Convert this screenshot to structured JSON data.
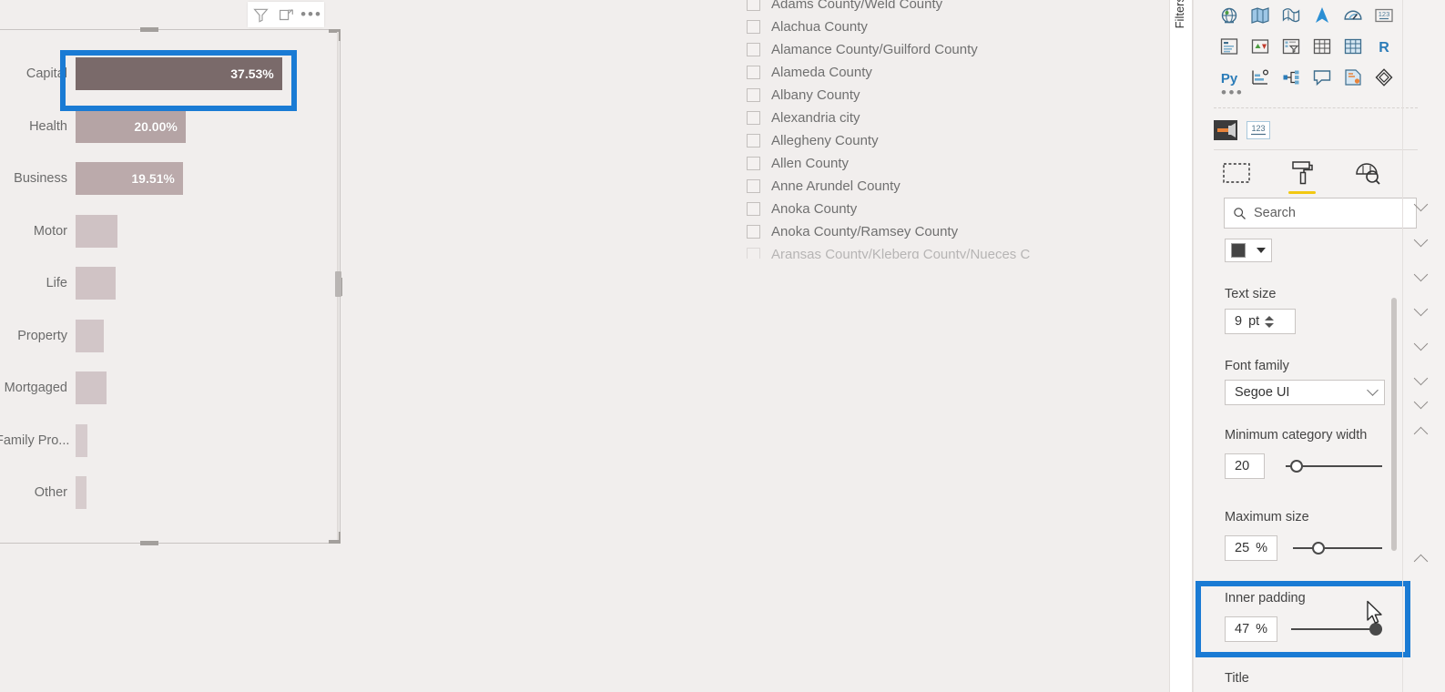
{
  "visual_header": {
    "filter_icon": "funnel-icon",
    "focus_icon": "focus-mode-icon",
    "more_label": "•••"
  },
  "chart_data": {
    "type": "bar",
    "orientation": "horizontal",
    "title": "",
    "xlabel": "",
    "ylabel": "",
    "categories": [
      "Capital",
      "Health",
      "Business",
      "Motor",
      "Life",
      "Property",
      "Mortgaged",
      "Family Pro...",
      "Other"
    ],
    "values": [
      37.53,
      20.0,
      19.51,
      7.6,
      7.2,
      5.1,
      5.6,
      2.1,
      2.0
    ],
    "value_labels": [
      "37.53%",
      "20.00%",
      "19.51%",
      "",
      "",
      "",
      "",
      "",
      ""
    ],
    "bar_colors": [
      "#7a6a6a",
      "#b5a4a5",
      "#bbaaab",
      "#cfc2c4",
      "#d0c3c5",
      "#d2c6c8",
      "#d1c5c7",
      "#d6cbcd",
      "#d7cccd"
    ],
    "grid": false,
    "legend": "none",
    "xlim": [
      0,
      48
    ]
  },
  "bar_highlight": {
    "color": "#1a7bd4",
    "target": "Capital"
  },
  "slicer": {
    "items": [
      {
        "label": "Adams County/Weld County",
        "checked": false
      },
      {
        "label": "Alachua County",
        "checked": false
      },
      {
        "label": "Alamance County/Guilford County",
        "checked": false
      },
      {
        "label": "Alameda County",
        "checked": false
      },
      {
        "label": "Albany County",
        "checked": false
      },
      {
        "label": "Alexandria city",
        "checked": false
      },
      {
        "label": "Allegheny County",
        "checked": false
      },
      {
        "label": "Allen County",
        "checked": false
      },
      {
        "label": "Anne Arundel County",
        "checked": false
      },
      {
        "label": "Anoka County",
        "checked": false
      },
      {
        "label": "Anoka County/Ramsey County",
        "checked": false
      },
      {
        "label": "Aransas County/Kleberg County/Nueces C",
        "checked": false
      }
    ]
  },
  "filters_pane": {
    "title": "Filters"
  },
  "viz_panel": {
    "gallery_icons": [
      "globe-map-icon",
      "filled-map-icon",
      "shape-map-icon",
      "arcgis-map-icon",
      "gauge-icon",
      "card-number-icon",
      "multi-row-card-icon",
      "kpi-icon",
      "slicer-icon",
      "table-icon",
      "matrix-icon",
      "r-script-icon",
      "python-script-icon",
      "key-influencers-icon",
      "decomposition-tree-icon",
      "smart-narrative-icon",
      "paginated-report-icon",
      "power-apps-icon"
    ],
    "more_visuals_label": "•••",
    "field_wells": [
      "format-bar-icon",
      "numeric-123-icon"
    ],
    "tabs": [
      {
        "name": "fields-tab",
        "icon": "fields-dashed-box-icon",
        "active": false
      },
      {
        "name": "format-tab",
        "icon": "paint-roller-icon",
        "active": true
      },
      {
        "name": "analytics-tab",
        "icon": "magnifier-chart-icon",
        "active": false
      }
    ],
    "search": {
      "placeholder": "Search",
      "value": "",
      "icon": "search-icon"
    },
    "color_picker": {
      "swatch": "#444444",
      "name": "color-swatch"
    },
    "text_size": {
      "label": "Text size",
      "value": "9",
      "unit": "pt"
    },
    "font_family": {
      "label": "Font family",
      "value": "Segoe UI"
    },
    "minimum_category_width": {
      "label": "Minimum category width",
      "value": "20",
      "unit": "",
      "slider_pct": 5
    },
    "maximum_size": {
      "label": "Maximum size",
      "value": "25",
      "unit": "%",
      "slider_pct": 25
    },
    "inner_padding": {
      "label": "Inner padding",
      "value": "47",
      "unit": "%",
      "slider_pct": 100
    },
    "title_section": {
      "label": "Title"
    },
    "accent_color": "#f2c811",
    "highlight_color": "#1a7bd4"
  }
}
